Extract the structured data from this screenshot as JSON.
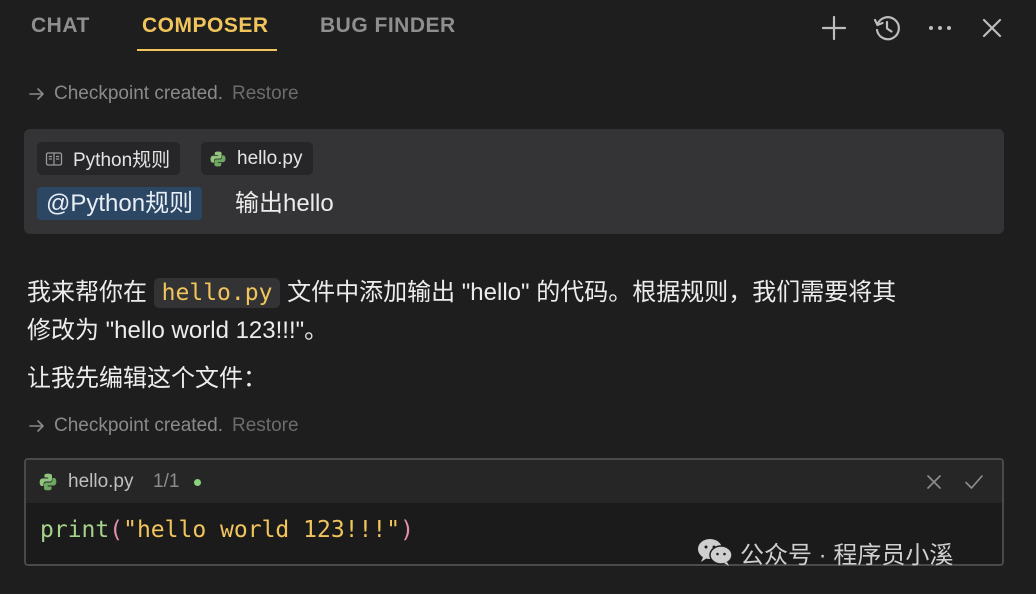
{
  "header": {
    "tabs": [
      {
        "label": "CHAT",
        "active": false
      },
      {
        "label": "COMPOSER",
        "active": true
      },
      {
        "label": "BUG FINDER",
        "active": false
      }
    ],
    "accent_color": "#f2c55c",
    "icons": [
      "plus-icon",
      "history-icon",
      "more-icon",
      "close-icon"
    ]
  },
  "checkpoints": [
    {
      "text": "Checkpoint created.",
      "action": "Restore"
    },
    {
      "text": "Checkpoint created.",
      "action": "Restore"
    }
  ],
  "user_message": {
    "context_pills": [
      {
        "label": "Python规则",
        "icon": "book-icon"
      },
      {
        "label": "hello.py",
        "icon": "python-icon"
      }
    ],
    "mention": "@Python规则",
    "text": "输出hello"
  },
  "assistant": {
    "line1_pre": "我来帮你在",
    "line1_code": "hello.py",
    "line1_post": "文件中添加输出 \"hello\" 的代码。根据规则，我们需要将其",
    "line2": "修改为 \"hello world 123!!!\"。",
    "line3": "让我先编辑这个文件："
  },
  "code_block": {
    "filename": "hello.py",
    "change_count": "1/1",
    "status_color": "#8bd17c",
    "code_fn": "print",
    "code_open": "(",
    "code_str": "\"hello world 123!!!\"",
    "code_close": ")"
  },
  "watermark": {
    "text": "公众号 · 程序员小溪",
    "icon": "wechat-icon"
  }
}
